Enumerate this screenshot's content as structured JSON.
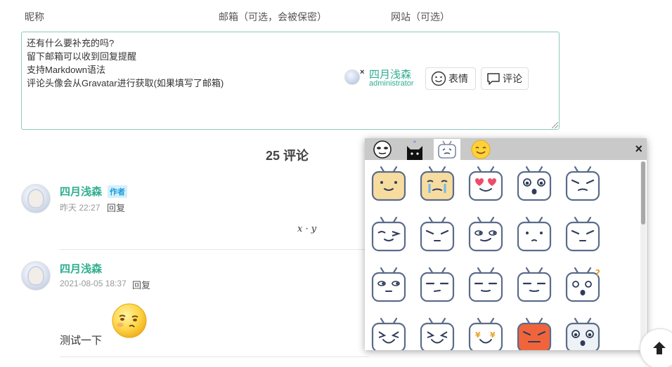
{
  "form": {
    "nickname_label": "昵称",
    "email_label": "邮箱（可选，会被保密）",
    "website_label": "网站（可选）",
    "placeholder_text": "还有什么要补充的吗?\n留下邮箱可以收到回复提醒\n支持Markdown语法\n评论头像会从Gravatar进行获取(如果填写了邮箱)",
    "user_name": "四月浅森",
    "user_role": "administrator",
    "logout_symbol": "×",
    "emoji_button": "表情",
    "comment_button": "评论"
  },
  "comments_header": {
    "count_label": "25 评论"
  },
  "comments": [
    {
      "author": "四月浅森",
      "badge": "作者",
      "time": "昨天 22:27",
      "reply": "回复",
      "math": "x · y"
    },
    {
      "author": "四月浅森",
      "time": "2021-08-05 18:37",
      "reply": "回复",
      "text": "测试一下"
    }
  ],
  "emoji_panel": {
    "close_symbol": "×",
    "tabs": [
      "face-tab-icon",
      "cat-tab-icon",
      "bilibili-tv-tab-icon",
      "yellow-smile-tab-icon"
    ],
    "active_tab": 2,
    "emojis": [
      "doge-tv-icon",
      "crying-tv-icon",
      "heart-eyes-tv-icon",
      "scared-tv-icon",
      "sad-tv-icon",
      "wink-tv-icon",
      "sweat-tv-icon",
      "smirk-tv-icon",
      "shy-tv-icon",
      "sneeze-tv-icon",
      "sleepy-tv-icon",
      "doubt-tv-icon",
      "think-tv-icon",
      "smug-tv-icon",
      "question-tv-icon",
      "laugh-tv-icon",
      "cry-laugh-tv-icon",
      "money-tv-icon",
      "angry-tv-icon",
      "shock-tv-icon"
    ]
  },
  "colors": {
    "accent_green": "#2fae8f",
    "badge_blue": "#1a9bd7",
    "panel_tab_bg": "#c9c9c9"
  }
}
